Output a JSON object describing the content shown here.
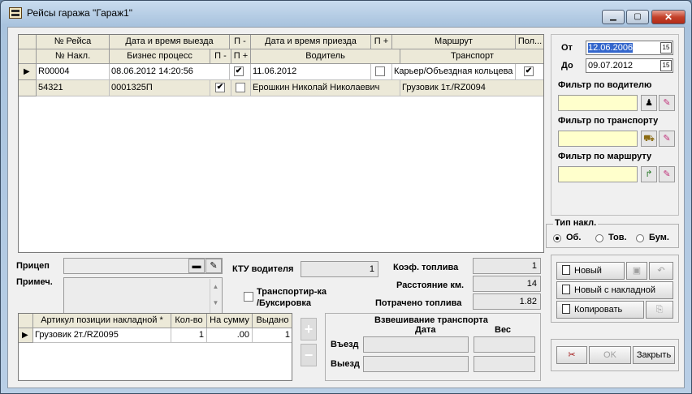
{
  "window": {
    "title": "Рейсы гаража \"Гараж1\"",
    "min_glyph": "▁",
    "max_glyph": "▢",
    "close_glyph": "✕"
  },
  "grid": {
    "header1": [
      "№ Рейса",
      "Дата и время выезда",
      "П -",
      "Дата и время приезда",
      "П +",
      "Маршрут",
      "Пол..."
    ],
    "header2": [
      "№ Накл.",
      "Бизнес процесс",
      "П -",
      "П +",
      "Водитель",
      "Транспорт"
    ],
    "rows": [
      {
        "trip_no": "R00004",
        "depart": "08.06.2012 14:20:56",
        "arrive": "11.06.2012",
        "route": "Карьер/Объездная кольцева",
        "invoice": "",
        "process": "",
        "driver": "",
        "transport": "",
        "check_depart": "✔",
        "check_arrive": "",
        "check_full": "✔"
      },
      {
        "trip_no": "54321",
        "depart": "0001325П",
        "arrive": "Ерошкин Николай Николаевич",
        "route": "Грузовик 1т./RZ0094",
        "check_depart": "✔",
        "check_arrive": ""
      }
    ]
  },
  "filters": {
    "from_label": "От",
    "from_value": "12.06.2006",
    "to_label": "До",
    "to_value": "09.07.2012",
    "cal_glyph": "15",
    "driver_label": "Фильтр по водителю",
    "transport_label": "Фильтр по транспорту",
    "route_label": "Фильтр по маршруту"
  },
  "invoice_type": {
    "label": "Тип накл.",
    "options": [
      "Об.",
      "Тов.",
      "Бум."
    ],
    "selected": 0
  },
  "details": {
    "trailer_label": "Прицеп",
    "note_label": "Примеч.",
    "ktu_label": "КТУ водителя",
    "ktu_value": "1",
    "tow_label_1": "Транспортир-ка",
    "tow_label_2": "/Буксировка",
    "fuel_coef_label": "Коэф. топлива",
    "fuel_coef_value": "1",
    "distance_label": "Расстояние км.",
    "distance_value": "14",
    "fuel_spent_label": "Потрачено топлива",
    "fuel_spent_value": "1.82"
  },
  "items_grid": {
    "headers": [
      "Артикул позиции накладной *",
      "Кол-во",
      "На сумму",
      "Выдано"
    ],
    "rows": [
      {
        "article": "Грузовик 2т./RZ0095",
        "qty": "1",
        "sum": ".00",
        "issued": "1"
      }
    ]
  },
  "weighing": {
    "title": "Взвешивание транспорта",
    "date_label": "Дата",
    "weight_label": "Вес",
    "entry_label": "Въезд",
    "exit_label": "Выезд"
  },
  "buttons": {
    "new": "Новый",
    "new_with_invoice": "Новый с накладной",
    "copy": "Копировать",
    "ok": "OK",
    "close": "Закрыть",
    "plus": "+",
    "minus": "−"
  }
}
